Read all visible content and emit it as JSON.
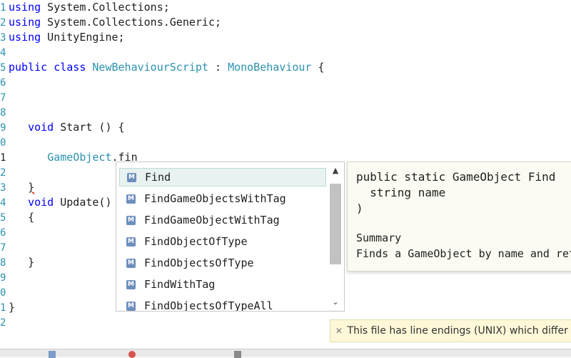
{
  "editor": {
    "lines": [
      {
        "n": "1",
        "parts": [
          {
            "t": "using",
            "c": "kw"
          },
          {
            "t": " System.Collections;",
            "c": ""
          }
        ]
      },
      {
        "n": "2",
        "parts": [
          {
            "t": "using",
            "c": "kw"
          },
          {
            "t": " System.Collections.Generic;",
            "c": ""
          }
        ]
      },
      {
        "n": "3",
        "parts": [
          {
            "t": "using",
            "c": "kw"
          },
          {
            "t": " UnityEngine;",
            "c": ""
          }
        ]
      },
      {
        "n": "4",
        "parts": []
      },
      {
        "n": "5",
        "parts": [
          {
            "t": "public",
            "c": "kw"
          },
          {
            "t": " ",
            "c": ""
          },
          {
            "t": "class",
            "c": "kw"
          },
          {
            "t": " ",
            "c": ""
          },
          {
            "t": "NewBehaviourScript",
            "c": "ty"
          },
          {
            "t": " : ",
            "c": ""
          },
          {
            "t": "MonoBehaviour",
            "c": "ty"
          },
          {
            "t": " {",
            "c": ""
          }
        ]
      },
      {
        "n": "6",
        "parts": []
      },
      {
        "n": "7",
        "parts": []
      },
      {
        "n": "8",
        "parts": []
      },
      {
        "n": "9",
        "parts": [
          {
            "t": "   ",
            "c": ""
          },
          {
            "t": "void",
            "c": "kw"
          },
          {
            "t": " Start () {",
            "c": ""
          }
        ]
      },
      {
        "n": "0",
        "parts": []
      },
      {
        "n": "1",
        "current": true,
        "parts": [
          {
            "t": "      ",
            "c": ""
          },
          {
            "t": "GameObject",
            "c": "ty"
          },
          {
            "t": ".fin",
            "c": ""
          }
        ]
      },
      {
        "n": "2",
        "parts": []
      },
      {
        "n": "3",
        "parts": [
          {
            "t": "   ",
            "c": ""
          },
          {
            "t": "}",
            "c": "squig"
          }
        ]
      },
      {
        "n": "4",
        "parts": [
          {
            "t": "   ",
            "c": ""
          },
          {
            "t": "void",
            "c": "kw"
          },
          {
            "t": " Update()",
            "c": ""
          }
        ]
      },
      {
        "n": "5",
        "parts": [
          {
            "t": "   {",
            "c": ""
          }
        ]
      },
      {
        "n": "6",
        "parts": []
      },
      {
        "n": "7",
        "parts": []
      },
      {
        "n": "8",
        "parts": [
          {
            "t": "   }",
            "c": ""
          }
        ]
      },
      {
        "n": "9",
        "parts": []
      },
      {
        "n": "0",
        "parts": []
      },
      {
        "n": "1",
        "parts": [
          {
            "t": "}",
            "c": ""
          }
        ]
      },
      {
        "n": "2",
        "parts": []
      }
    ]
  },
  "autocomplete": {
    "icon_letter": "M",
    "items": [
      {
        "label": "Find",
        "selected": true
      },
      {
        "label": "FindGameObjectsWithTag"
      },
      {
        "label": "FindGameObjectWithTag"
      },
      {
        "label": "FindObjectOfType"
      },
      {
        "label": "FindObjectsOfType"
      },
      {
        "label": "FindWithTag"
      },
      {
        "label": "FindObjectsOfTypeAll"
      }
    ],
    "scroll_up": "▲",
    "scroll_down": "⌄"
  },
  "tooltip": {
    "signature": "public static GameObject Find\n  string name\n)",
    "summary_heading": "Summary",
    "summary_text": "Finds a GameObject by name and ret"
  },
  "notice": {
    "close": "✕",
    "text": "This file has line endings (UNIX) which differ fr"
  },
  "colors": {
    "keyword": "#0000ff",
    "type": "#2b91af",
    "line_number": "#2b91af",
    "selection": "#e8f2f1",
    "notice_bg": "#fdf8d8"
  }
}
